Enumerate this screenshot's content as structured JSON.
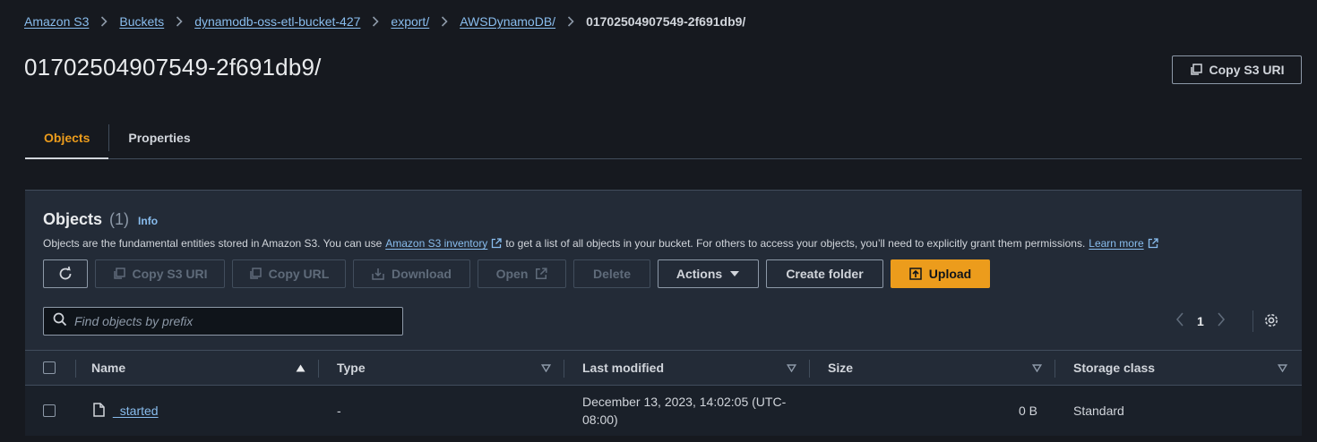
{
  "breadcrumb": {
    "items": [
      "Amazon S3",
      "Buckets",
      "dynamodb-oss-etl-bucket-427",
      "export/",
      "AWSDynamoDB/"
    ],
    "current": "01702504907549-2f691db9/"
  },
  "page": {
    "title": "01702504907549-2f691db9/",
    "copy_s3_uri_label": "Copy S3 URI"
  },
  "tabs": [
    {
      "label": "Objects",
      "active": true
    },
    {
      "label": "Properties",
      "active": false
    }
  ],
  "objects_panel": {
    "title": "Objects",
    "count": "(1)",
    "info_label": "Info",
    "description_prefix": "Objects are the fundamental entities stored in Amazon S3. You can use",
    "inventory_link": "Amazon S3 inventory",
    "description_middle": "to get a list of all objects in your bucket. For others to access your objects, you’ll need to explicitly grant them permissions.",
    "learn_more_link": "Learn more"
  },
  "toolbar": {
    "copy_s3_uri": "Copy S3 URI",
    "copy_url": "Copy URL",
    "download": "Download",
    "open": "Open",
    "delete": "Delete",
    "actions": "Actions",
    "create_folder": "Create folder",
    "upload": "Upload"
  },
  "search": {
    "placeholder": "Find objects by prefix",
    "value": ""
  },
  "pagination": {
    "current_page": "1"
  },
  "table": {
    "columns": [
      "Name",
      "Type",
      "Last modified",
      "Size",
      "Storage class"
    ],
    "rows": [
      {
        "name": "_started",
        "type": "-",
        "last_modified_line1": "December 13, 2023, 14:02:05 (UTC-",
        "last_modified_line2": "08:00)",
        "size": "0 B",
        "storage_class": "Standard"
      }
    ]
  },
  "colors": {
    "background": "#16191f",
    "panel": "#232b37",
    "accent": "#ec9c1c",
    "link": "#89bdee"
  }
}
